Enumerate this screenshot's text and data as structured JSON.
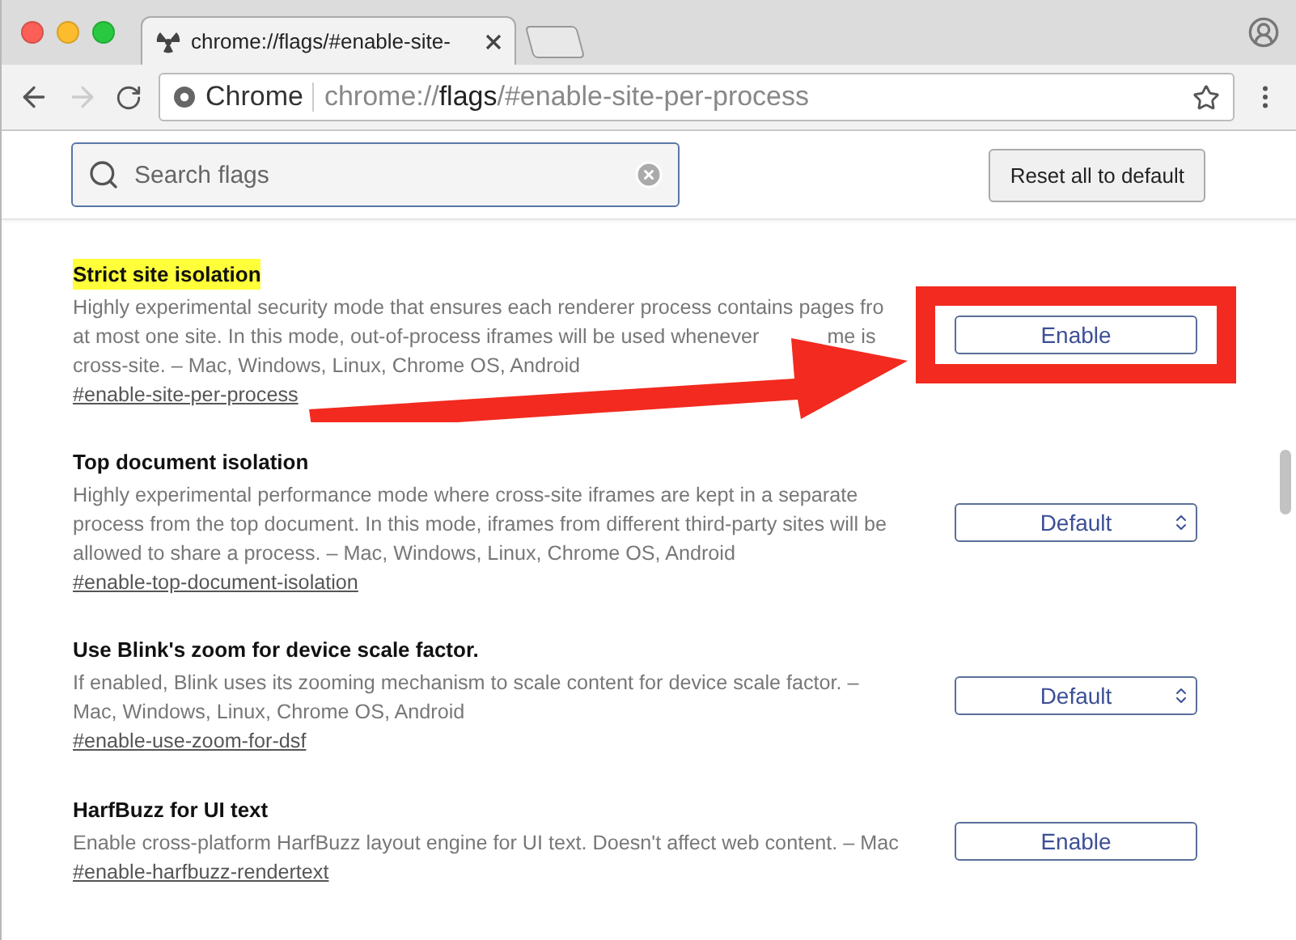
{
  "window": {
    "tab_title": "chrome://flags/#enable-site-"
  },
  "address_bar": {
    "site_label": "Chrome",
    "url_prefix": "chrome://",
    "url_bold": "flags",
    "url_suffix": "/#enable-site-per-process"
  },
  "search": {
    "placeholder": "Search flags"
  },
  "reset_button": "Reset all to default",
  "flags": [
    {
      "title": "Strict site isolation",
      "title_highlighted": true,
      "lines": [
        {
          "text": "Highly experimental security mode that ensures each renderer process contains pages fro"
        },
        {
          "text": "at most one site. In this mode, out-of-process iframes will be used whenever",
          "tail": "me is"
        },
        {
          "text": "cross-site.  – Mac, Windows, Linux, Chrome OS, Android"
        }
      ],
      "link": "#enable-site-per-process",
      "control": {
        "kind": "button",
        "label": "Enable"
      },
      "annotated": true
    },
    {
      "title": "Top document isolation",
      "title_highlighted": false,
      "lines": [
        {
          "text": "Highly experimental performance mode where cross-site iframes are kept in a separate"
        },
        {
          "text": "process from the top document. In this mode, iframes from different third-party sites will be"
        },
        {
          "text": "allowed to share a process.  – Mac, Windows, Linux, Chrome OS, Android"
        }
      ],
      "link": "#enable-top-document-isolation",
      "control": {
        "kind": "select",
        "label": "Default"
      },
      "annotated": false
    },
    {
      "title": "Use Blink's zoom for device scale factor.",
      "title_highlighted": false,
      "lines": [
        {
          "text": "If enabled, Blink uses its zooming mechanism to scale content for device scale factor.  –"
        },
        {
          "text": "Mac, Windows, Linux, Chrome OS, Android"
        }
      ],
      "link": "#enable-use-zoom-for-dsf",
      "control": {
        "kind": "select",
        "label": "Default"
      },
      "annotated": false
    },
    {
      "title": "HarfBuzz for UI text",
      "title_highlighted": false,
      "lines": [
        {
          "text": "Enable cross-platform HarfBuzz layout engine for UI text. Doesn't affect web content.  – Mac"
        }
      ],
      "link": "#enable-harfbuzz-rendertext",
      "control": {
        "kind": "button",
        "label": "Enable"
      },
      "annotated": false
    }
  ]
}
